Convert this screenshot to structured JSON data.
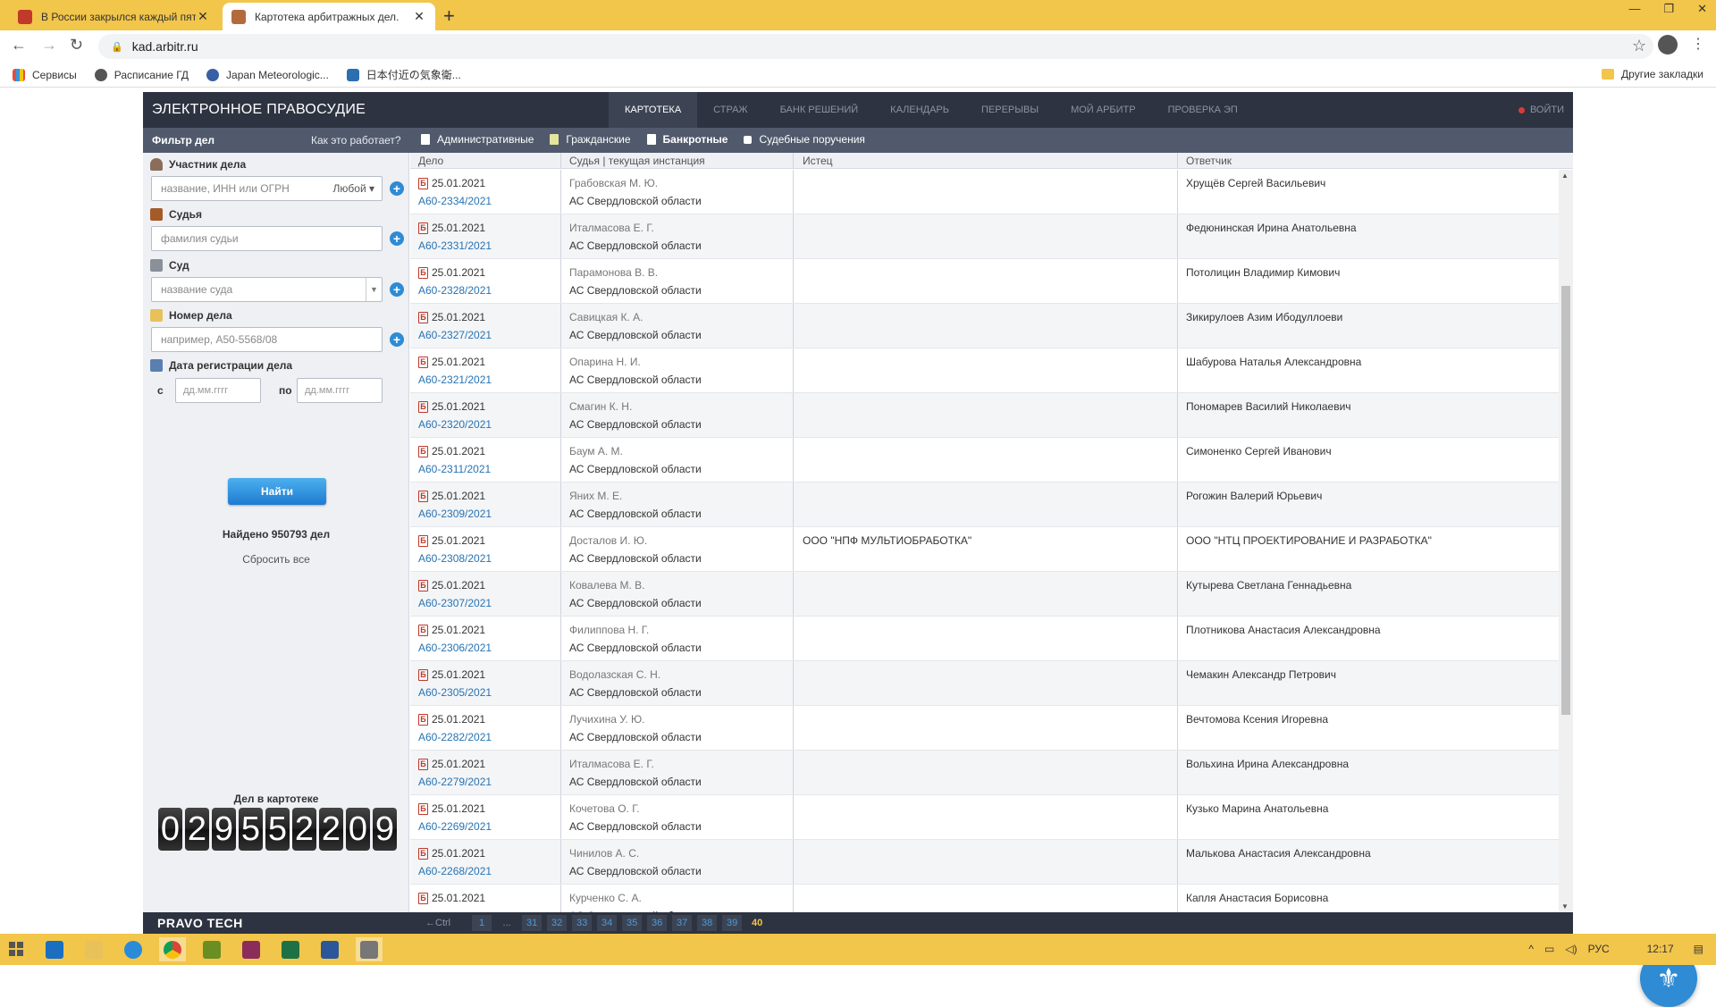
{
  "browser": {
    "tabs": [
      {
        "title": "В России закрылся каждый пят",
        "active": false
      },
      {
        "title": "Картотека арбитражных дел.",
        "active": true
      }
    ],
    "url": "kad.arbitr.ru",
    "bookmarks": [
      "Сервисы",
      "Расписание ГД",
      "Japan Meteorologic...",
      "日本付近の気象衛..."
    ],
    "other_bookmarks": "Другие закладки"
  },
  "site": {
    "logo": "ЭЛЕКТРОННОЕ ПРАВОСУДИЕ",
    "nav": [
      "КАРТОТЕКА",
      "СТРАЖ",
      "БАНК РЕШЕНИЙ",
      "КАЛЕНДАРЬ",
      "ПЕРЕРЫВЫ",
      "МОЙ АРБИТР",
      "ПРОВЕРКА ЭП"
    ],
    "login": "ВОЙТИ",
    "filter_title": "Фильтр дел",
    "how_it_works": "Как это работает?",
    "categories": [
      "Административные",
      "Гражданские",
      "Банкротные",
      "Судебные поручения"
    ]
  },
  "filters": {
    "participant": {
      "label": "Участник дела",
      "placeholder": "название, ИНН или ОГРН",
      "role": "Любой"
    },
    "judge": {
      "label": "Судья",
      "placeholder": "фамилия судьи"
    },
    "court": {
      "label": "Суд",
      "placeholder": "название суда"
    },
    "case_number": {
      "label": "Номер дела",
      "placeholder": "например, А50-5568/08"
    },
    "reg_date": {
      "label": "Дата регистрации дела",
      "from_label": "с",
      "to_label": "по",
      "from_placeholder": "дд.мм.гггг",
      "to_placeholder": "дд.мм.гггг"
    },
    "find_button": "Найти",
    "found": "Найдено 950793 дел",
    "reset": "Сбросить все",
    "counter_label": "Дел в картотеке",
    "counter_digits": [
      "0",
      "2",
      "9",
      "5",
      "5",
      "2",
      "2",
      "0",
      "9"
    ]
  },
  "table": {
    "headers": [
      "Дело",
      "Судья | текущая инстанция",
      "Истец",
      "Ответчик"
    ],
    "court": "АС Свердловской области",
    "rows": [
      {
        "date": "25.01.2021",
        "number": "А60-2334/2021",
        "judge": "Грабовская М. Ю.",
        "plaintiff": "",
        "defendant": "Хрущёв Сергей Васильевич"
      },
      {
        "date": "25.01.2021",
        "number": "А60-2331/2021",
        "judge": "Италмасова Е. Г.",
        "plaintiff": "",
        "defendant": "Федюнинская Ирина Анатольевна"
      },
      {
        "date": "25.01.2021",
        "number": "А60-2328/2021",
        "judge": "Парамонова В. В.",
        "plaintiff": "",
        "defendant": "Потолицин Владимир Кимович"
      },
      {
        "date": "25.01.2021",
        "number": "А60-2327/2021",
        "judge": "Савицкая К. А.",
        "plaintiff": "",
        "defendant": "Зикирулоев Азим Ибодуллоеви"
      },
      {
        "date": "25.01.2021",
        "number": "А60-2321/2021",
        "judge": "Опарина Н. И.",
        "plaintiff": "",
        "defendant": "Шабурова Наталья Александровна"
      },
      {
        "date": "25.01.2021",
        "number": "А60-2320/2021",
        "judge": "Смагин К. Н.",
        "plaintiff": "",
        "defendant": "Пономарев Василий Николаевич"
      },
      {
        "date": "25.01.2021",
        "number": "А60-2311/2021",
        "judge": "Баум А. М.",
        "plaintiff": "",
        "defendant": "Симоненко Сергей Иванович"
      },
      {
        "date": "25.01.2021",
        "number": "А60-2309/2021",
        "judge": "Яних М. Е.",
        "plaintiff": "",
        "defendant": "Рогожин Валерий Юрьевич"
      },
      {
        "date": "25.01.2021",
        "number": "А60-2308/2021",
        "judge": "Досталов И. Ю.",
        "plaintiff": "ООО \"НПФ МУЛЬТИОБРАБОТКА\"",
        "defendant": "ООО \"НТЦ ПРОЕКТИРОВАНИЕ И РАЗРАБОТКА\""
      },
      {
        "date": "25.01.2021",
        "number": "А60-2307/2021",
        "judge": "Ковалева М. В.",
        "plaintiff": "",
        "defendant": "Кутырева Светлана Геннадьевна"
      },
      {
        "date": "25.01.2021",
        "number": "А60-2306/2021",
        "judge": "Филиппова Н. Г.",
        "plaintiff": "",
        "defendant": "Плотникова Анастасия Александровна"
      },
      {
        "date": "25.01.2021",
        "number": "А60-2305/2021",
        "judge": "Водолазская С. Н.",
        "plaintiff": "",
        "defendant": "Чемакин Александр Петрович"
      },
      {
        "date": "25.01.2021",
        "number": "А60-2282/2021",
        "judge": "Лучихина У. Ю.",
        "plaintiff": "",
        "defendant": "Вечтомова Ксения Игоревна"
      },
      {
        "date": "25.01.2021",
        "number": "А60-2279/2021",
        "judge": "Италмасова Е. Г.",
        "plaintiff": "",
        "defendant": "Вольхина Ирина Александровна"
      },
      {
        "date": "25.01.2021",
        "number": "А60-2269/2021",
        "judge": "Кочетова О. Г.",
        "plaintiff": "",
        "defendant": "Кузько Марина Анатольевна"
      },
      {
        "date": "25.01.2021",
        "number": "А60-2268/2021",
        "judge": "Чинилов А. С.",
        "plaintiff": "",
        "defendant": "Малькова Анастасия Александровна"
      },
      {
        "date": "25.01.2021",
        "number": "",
        "judge": "Курченко С. А.",
        "plaintiff": "",
        "defendant": "Капля Анастасия Борисовна"
      }
    ]
  },
  "footer": {
    "brand": "PRAVO TECH",
    "ctrl_hint": "←Ctrl",
    "pages": [
      "1",
      "...",
      "31",
      "32",
      "33",
      "34",
      "35",
      "36",
      "37",
      "38",
      "39",
      "40"
    ],
    "current_page": "40"
  },
  "taskbar": {
    "language": "РУС",
    "time": "12:17"
  },
  "colors": {
    "chrome_accent": "#f2c54b",
    "nav_bg": "#2d3340",
    "filter_bg": "#505a6c",
    "link": "#2673b3",
    "button": "#1d7bd1"
  }
}
